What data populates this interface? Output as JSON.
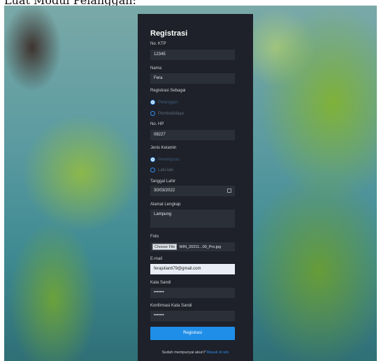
{
  "caption": "Luat Modul Pelanggan:",
  "form": {
    "title": "Registrasi",
    "ktp_label": "No. KTP",
    "ktp_value": "12345",
    "nama_label": "Nama",
    "nama_value": "Fera",
    "role_label": "Registrasi Sebagai",
    "role_options": [
      "Pelanggan",
      "Pembudidaya"
    ],
    "role_selected": "Pelanggan",
    "hp_label": "No. HP",
    "hp_value": "08227",
    "gender_label": "Jenis Kelamin",
    "gender_options": [
      "Perempuan",
      "Laki-laki"
    ],
    "gender_selected": "Perempuan",
    "dob_label": "Tanggal Lahir",
    "dob_value": "30/03/2022",
    "alamat_label": "Alamat Lengkap",
    "alamat_value": "Lampung",
    "foto_label": "Foto",
    "foto_button": "Choose File",
    "foto_filename": "WIN_20211...00_Pro.jpg",
    "email_label": "E-mail",
    "email_value": "ferajulianti79@gmail.com",
    "sandi_label": "Kata Sandi",
    "sandi_value": "•••••••",
    "konfirmasi_label": "Konfirmasi Kata Sandi",
    "konfirmasi_value": "•••••••",
    "submit_label": "Registrasi",
    "footer_text": "Sudah mempunyai akun?",
    "footer_link": "Masuk di sini"
  },
  "colors": {
    "accent": "#1f8ee8",
    "card_bg": "#1e2129",
    "input_bg": "#2b2f38"
  }
}
